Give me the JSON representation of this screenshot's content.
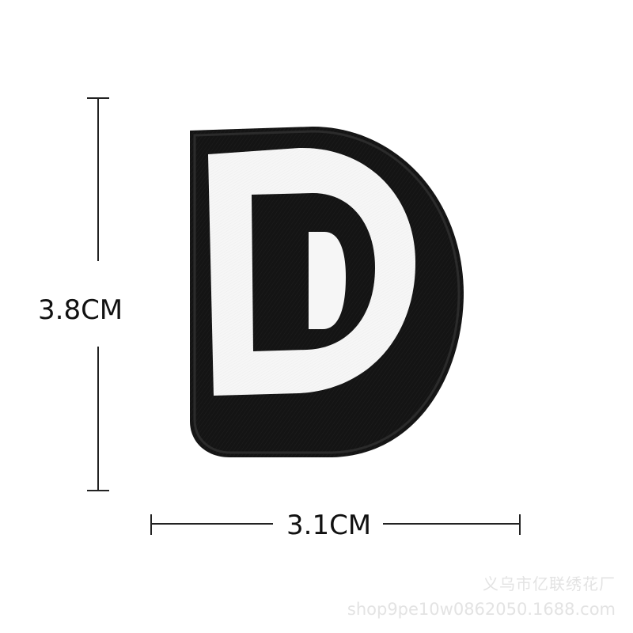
{
  "product": {
    "letter": "D",
    "patch_colors": {
      "outline": "#111111",
      "letter_fill": "#f7f7f7",
      "shadow": "#1e1e1e"
    }
  },
  "dimensions": {
    "height_label": "3.8CM",
    "width_label": "3.1CM"
  },
  "watermark": {
    "line1": "义乌市亿联绣花厂",
    "line2": "shop9pe10w0862050.1688.com"
  }
}
